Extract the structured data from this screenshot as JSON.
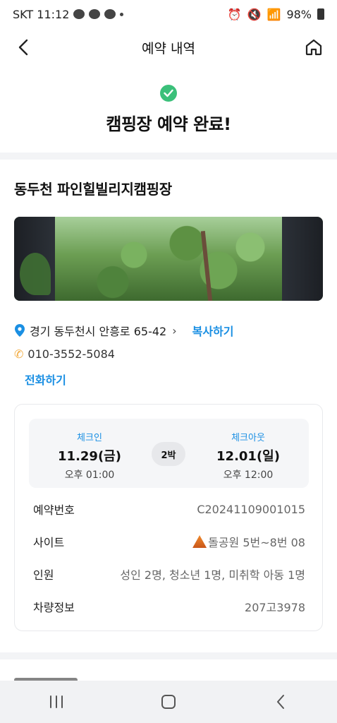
{
  "status_bar": {
    "carrier_time": "SKT 11:12",
    "battery": "98%"
  },
  "nav": {
    "title": "예약 내역"
  },
  "completion": {
    "title": "캠핑장 예약 완료!"
  },
  "campsite": {
    "name": "동두천 파인힐빌리지캠핑장",
    "address": "경기 동두천시 안흥로 65-42",
    "copy_label": "복사하기",
    "phone": "010-3552-5084",
    "call_label": "전화하기"
  },
  "booking": {
    "checkin_label": "체크인",
    "checkin_date": "11.29(금)",
    "checkin_time": "오후 01:00",
    "nights": "2박",
    "checkout_label": "체크아웃",
    "checkout_date": "12.01(일)",
    "checkout_time": "오후 12:00",
    "rows": [
      {
        "label": "예약번호",
        "value": "C20241109001015"
      },
      {
        "label": "사이트",
        "value": "돌공원 5번~8번 08"
      },
      {
        "label": "인원",
        "value": "성인 2명, 청소년 1명, 미취학 아동 1명"
      },
      {
        "label": "차량정보",
        "value": "207고3978"
      }
    ]
  },
  "colors": {
    "accent": "#1a8fe3",
    "success": "#3bc07a"
  }
}
